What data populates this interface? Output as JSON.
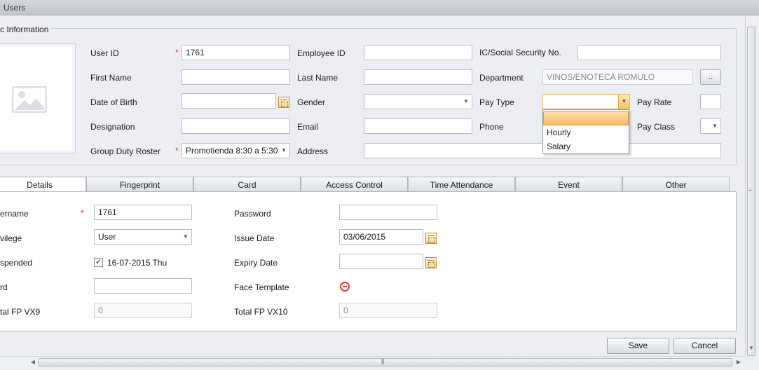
{
  "window": {
    "title": "Users"
  },
  "basic_info": {
    "legend": "c Information",
    "fields": {
      "user_id": {
        "label": "User ID",
        "value": "1761",
        "required": "*"
      },
      "employee_id": {
        "label": "Employee ID",
        "value": ""
      },
      "ic_social": {
        "label": "IC/Social Security No.",
        "value": ""
      },
      "first_name": {
        "label": "First Name",
        "value": ""
      },
      "last_name": {
        "label": "Last Name",
        "value": ""
      },
      "department": {
        "label": "Department",
        "value": "VINOS/ENOTECA ROMULO",
        "browse_label": ".."
      },
      "date_of_birth": {
        "label": "Date of Birth",
        "value": ""
      },
      "gender": {
        "label": "Gender",
        "value": ""
      },
      "pay_type": {
        "label": "Pay Type",
        "value": ""
      },
      "pay_rate": {
        "label": "Pay Rate",
        "value": ""
      },
      "designation": {
        "label": "Designation",
        "value": ""
      },
      "email": {
        "label": "Email",
        "value": ""
      },
      "phone": {
        "label": "Phone",
        "value": ""
      },
      "pay_class": {
        "label": "Pay Class",
        "value": ""
      },
      "group_duty_roster": {
        "label": "Group Duty Roster",
        "value": "Promotienda 8:30 a 5:30",
        "required": "*"
      },
      "address": {
        "label": "Address",
        "value": ""
      }
    },
    "pay_type_options": [
      "",
      "Hourly",
      "Salary"
    ]
  },
  "tabs": [
    "Details",
    "Fingerprint",
    "Card",
    "Access Control",
    "Time Attendance",
    "Event",
    "Other"
  ],
  "details": {
    "username": {
      "label": "ername",
      "value": "1761",
      "required": "*"
    },
    "password": {
      "label": "Password",
      "value": ""
    },
    "privilege": {
      "label": "vilege",
      "value": "User"
    },
    "issue_date": {
      "label": "Issue Date",
      "value": "03/06/2015"
    },
    "suspended": {
      "label": "spended",
      "checked": "✓",
      "text": "16-07-2015 Thu"
    },
    "expiry_date": {
      "label": "Expiry Date",
      "value": ""
    },
    "card": {
      "label": "rd",
      "value": ""
    },
    "face_template": {
      "label": "Face Template"
    },
    "total_fp_vx9": {
      "label": "tal FP VX9",
      "value": "0"
    },
    "total_fp_vx10": {
      "label": "Total FP VX10",
      "value": "0"
    }
  },
  "actions": {
    "save": "Save",
    "cancel": "Cancel"
  },
  "icons": {
    "photo": "image-placeholder-icon",
    "calendar": "calendar-icon",
    "face": "no-entry-icon"
  },
  "colors": {
    "required": "#d33333",
    "highlight": "#f7b968"
  }
}
